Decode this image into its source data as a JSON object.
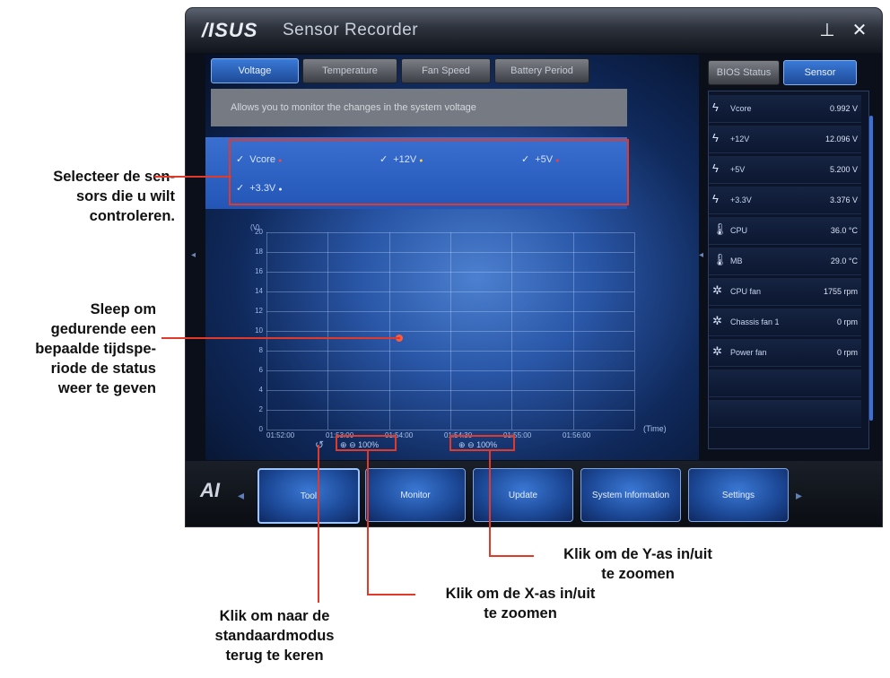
{
  "window": {
    "logo": "/ISUS",
    "title": "Sensor Recorder",
    "minimize": "⊥",
    "close": "✕"
  },
  "tabs": [
    "Voltage",
    "Temperature",
    "Fan Speed",
    "Battery Period"
  ],
  "description": "Allows you to monitor the changes in the system voltage",
  "sensors": [
    "Vcore",
    "+12V",
    "+5V",
    "+3.3V"
  ],
  "graph": {
    "y_max_label": "(V)",
    "y_ticks": [
      "20",
      "18",
      "16",
      "14",
      "12",
      "10",
      "8",
      "6",
      "4",
      "2",
      "0"
    ],
    "x_ticks": [
      "01:52:00",
      "01:53:00",
      "01:54:00",
      "01:54:30",
      "01:55:00",
      "01:56:00"
    ],
    "time_label": "(Time)",
    "x_zoom": "100%",
    "y_zoom": "100%"
  },
  "right_tabs": [
    "BIOS Status",
    "Sensor"
  ],
  "readings": [
    {
      "icon": "voltage-icon",
      "name": "Vcore",
      "value": "0.992 V"
    },
    {
      "icon": "voltage-icon",
      "name": "+12V",
      "value": "12.096 V"
    },
    {
      "icon": "voltage-icon",
      "name": "+5V",
      "value": "5.200 V"
    },
    {
      "icon": "voltage-icon",
      "name": "+3.3V",
      "value": "3.376 V"
    },
    {
      "icon": "temperature-icon",
      "name": "CPU",
      "value": "36.0 °C"
    },
    {
      "icon": "temperature-icon",
      "name": "MB",
      "value": "29.0 °C"
    },
    {
      "icon": "fan-icon",
      "name": "CPU fan",
      "value": "1755 rpm"
    },
    {
      "icon": "fan-icon",
      "name": "Chassis fan 1",
      "value": "0 rpm"
    },
    {
      "icon": "fan-icon",
      "name": "Power fan",
      "value": "0 rpm"
    }
  ],
  "dock": [
    "Tool",
    "Monitor",
    "Update",
    "System Information",
    "Settings"
  ],
  "annotations": {
    "select_sensors": [
      "Selecteer de sen-",
      "sors die u wilt",
      "controleren."
    ],
    "drag": [
      "Sleep om",
      "gedurende een",
      "bepaalde tijdspe-",
      "riode de status",
      "weer te geven"
    ],
    "y_zoom": [
      "Klik om de Y-as in/uit",
      "te zoomen"
    ],
    "x_zoom": [
      "Klik om de X-as in/uit",
      "te zoomen"
    ],
    "default_mode": [
      "Klik om naar de",
      "standaardmodus",
      "terug te keren"
    ]
  }
}
